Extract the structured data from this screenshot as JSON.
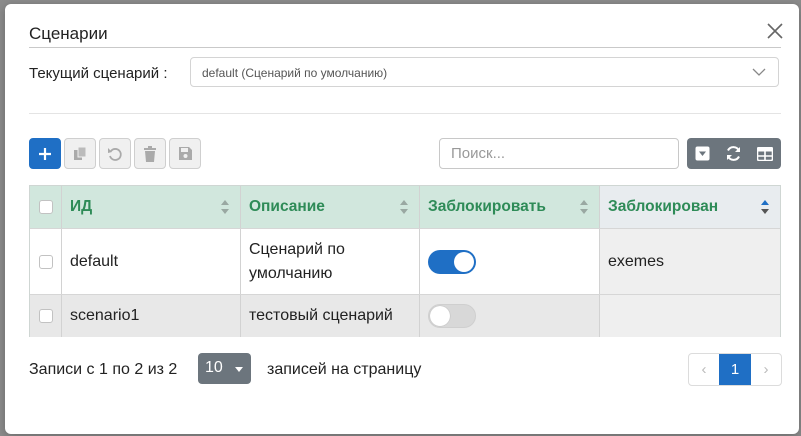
{
  "dialog": {
    "title": "Сценарии",
    "current_label": "Текущий сценарий :",
    "current_value": "default (Сценарий по умолчанию)"
  },
  "toolbar": {
    "buttons": [
      "add",
      "copy",
      "undo",
      "delete",
      "save"
    ],
    "search_placeholder": "Поиск...",
    "right_buttons": [
      "dropdown",
      "refresh",
      "columns"
    ]
  },
  "table": {
    "columns": [
      "ИД",
      "Описание",
      "Заблокировать",
      "Заблокирован"
    ],
    "sort_active_column": "Заблокирован",
    "rows": [
      {
        "id": "default",
        "description": "Сценарий по умолчанию",
        "lock_enabled": true,
        "locked_by": "exemes"
      },
      {
        "id": "scenario1",
        "description": "тестовый сценарий",
        "lock_enabled": false,
        "locked_by": ""
      }
    ]
  },
  "footer": {
    "info": "Записи с 1 по 2 из 2",
    "page_size": "10",
    "per_page_label": "записей на страницу",
    "prev": "‹",
    "current_page": "1",
    "next": "›"
  },
  "colors": {
    "primary": "#1f6fc5",
    "header_bg": "#d1e7dd",
    "header_text": "#2e8b57",
    "secondary_btn": "#6c757d"
  }
}
